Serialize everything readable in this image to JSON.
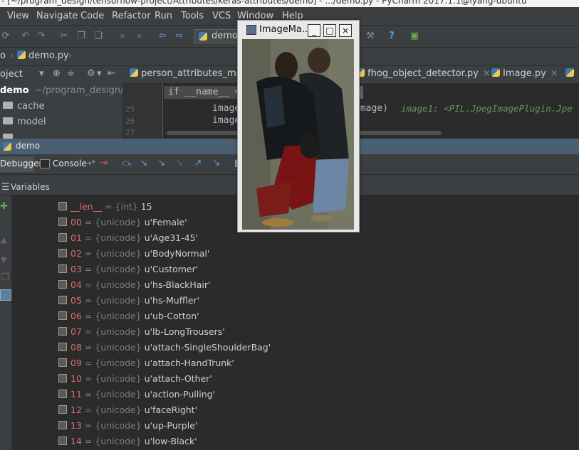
{
  "window": {
    "title": "- [~/program_design/tensorflow-project/Attributes/keras-attributes/demo] - .../demo.py - PyCharm 2017.1.1@lyang-ubuntu"
  },
  "menu": [
    "View",
    "Navigate",
    "Code",
    "Refactor",
    "Run",
    "Tools",
    "VCS",
    "Window",
    "Help"
  ],
  "toolbar": {
    "run_config": "demo"
  },
  "breadcrumb": {
    "partial": "o",
    "file": "demo.py"
  },
  "project": {
    "header": "oject",
    "root_name": "demo",
    "root_path": "~/program_design/te",
    "folders": [
      "cache",
      "model"
    ]
  },
  "tabs": [
    "person_attributes_mode",
    "fhog_object_detector.py",
    "Image.py"
  ],
  "editor": {
    "breadcrumb_hint": "if __name__ ==",
    "line_numbers": [
      "25",
      "26",
      "27"
    ],
    "line25_prefix": "image.",
    "line25_suffix": "image)",
    "line25_hint": "image1: <PIL.JpegImagePlugin.Jpe",
    "line26": "image."
  },
  "debug": {
    "session": "demo",
    "tab_debugger": "Debugger",
    "tab_console": "Console",
    "console_suffix": "→*",
    "variables_title": "Variables"
  },
  "variables": [
    {
      "name": "__len__",
      "type": "{int}",
      "value": "15"
    },
    {
      "name": "00",
      "type": "{unicode}",
      "value": "u'Female'"
    },
    {
      "name": "01",
      "type": "{unicode}",
      "value": "u'Age31-45'"
    },
    {
      "name": "02",
      "type": "{unicode}",
      "value": "u'BodyNormal'"
    },
    {
      "name": "03",
      "type": "{unicode}",
      "value": "u'Customer'"
    },
    {
      "name": "04",
      "type": "{unicode}",
      "value": "u'hs-BlackHair'"
    },
    {
      "name": "05",
      "type": "{unicode}",
      "value": "u'hs-Muffler'"
    },
    {
      "name": "06",
      "type": "{unicode}",
      "value": "u'ub-Cotton'"
    },
    {
      "name": "07",
      "type": "{unicode}",
      "value": "u'lb-LongTrousers'"
    },
    {
      "name": "08",
      "type": "{unicode}",
      "value": "u'attach-SingleShoulderBag'"
    },
    {
      "name": "09",
      "type": "{unicode}",
      "value": "u'attach-HandTrunk'"
    },
    {
      "name": "10",
      "type": "{unicode}",
      "value": "u'attach-Other'"
    },
    {
      "name": "11",
      "type": "{unicode}",
      "value": "u'action-Pulling'"
    },
    {
      "name": "12",
      "type": "{unicode}",
      "value": "u'faceRight'"
    },
    {
      "name": "13",
      "type": "{unicode}",
      "value": "u'up-Purple'"
    },
    {
      "name": "14",
      "type": "{unicode}",
      "value": "u'low-Black'"
    }
  ],
  "image_window": {
    "title": "ImageMa...",
    "btn_min": "_",
    "btn_max": "□",
    "btn_close": "×"
  },
  "colors": {
    "accent": "#4b5f73",
    "var_name": "#e06a6a",
    "background": "#2b2b2b"
  }
}
